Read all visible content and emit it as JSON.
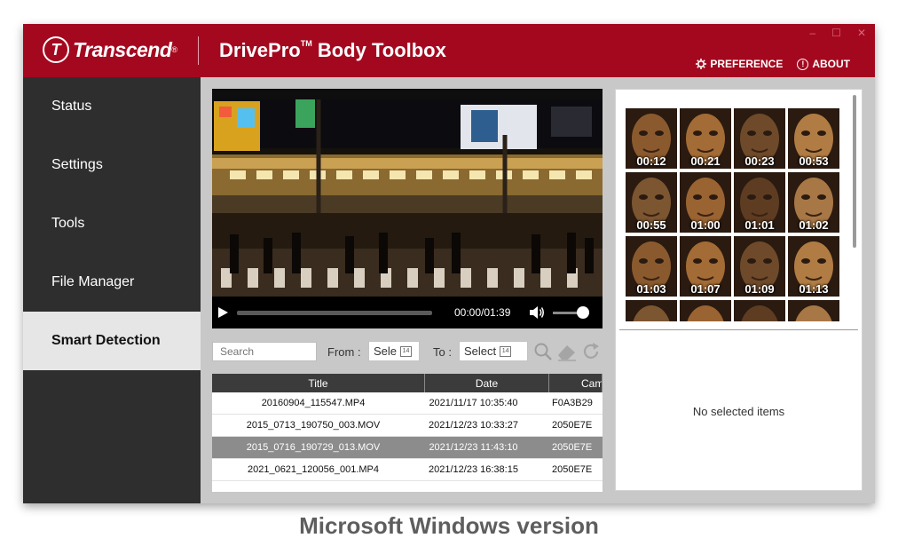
{
  "brand": {
    "logo_mark": "T",
    "name": "Transcend",
    "reg": "®"
  },
  "app": {
    "title": "DrivePro",
    "tm": "TM",
    "title_suffix": " Body Toolbox"
  },
  "window_controls": {
    "minimize": "–",
    "maximize": "☐",
    "close": "✕"
  },
  "actions": {
    "preference": "PREFERENCE",
    "about": "ABOUT"
  },
  "nav": [
    {
      "label": "Status"
    },
    {
      "label": "Settings"
    },
    {
      "label": "Tools"
    },
    {
      "label": "File Manager"
    },
    {
      "label": "Smart Detection",
      "active": true
    }
  ],
  "player": {
    "time": "00:00/01:39",
    "progress": 0,
    "volume": 0.85
  },
  "filters": {
    "search_placeholder": "Search",
    "from_label": "From :",
    "from_value": "Sele",
    "to_label": "To :",
    "to_value": "Select",
    "calendar_glyph": "14"
  },
  "table": {
    "columns": [
      "Title",
      "Date",
      "Camera"
    ],
    "rows": [
      {
        "title": "20160904_115547.MP4",
        "date": "2021/11/17 10:35:40",
        "camera": "F0A3B29"
      },
      {
        "title": "2015_0713_190750_003.MOV",
        "date": "2021/12/23 10:33:27",
        "camera": "2050E7E"
      },
      {
        "title": "2015_0716_190729_013.MOV",
        "date": "2021/12/23 11:43:10",
        "camera": "2050E7E",
        "selected": true
      },
      {
        "title": "2021_0621_120056_001.MP4",
        "date": "2021/12/23 16:38:15",
        "camera": "2050E7E"
      }
    ]
  },
  "detections": [
    {
      "time": "00:12"
    },
    {
      "time": "00:21"
    },
    {
      "time": "00:23"
    },
    {
      "time": "00:53"
    },
    {
      "time": "00:55"
    },
    {
      "time": "01:00"
    },
    {
      "time": "01:01"
    },
    {
      "time": "01:02"
    },
    {
      "time": "01:03"
    },
    {
      "time": "01:07"
    },
    {
      "time": "01:09"
    },
    {
      "time": "01:13"
    },
    {
      "time": ""
    },
    {
      "time": ""
    },
    {
      "time": ""
    },
    {
      "time": ""
    }
  ],
  "selection_empty": "No selected items",
  "caption": "Microsoft Windows version",
  "colors": {
    "brand_red": "#a4081f",
    "sidebar": "#2e2e2e",
    "active_nav": "#e6e6e6"
  }
}
